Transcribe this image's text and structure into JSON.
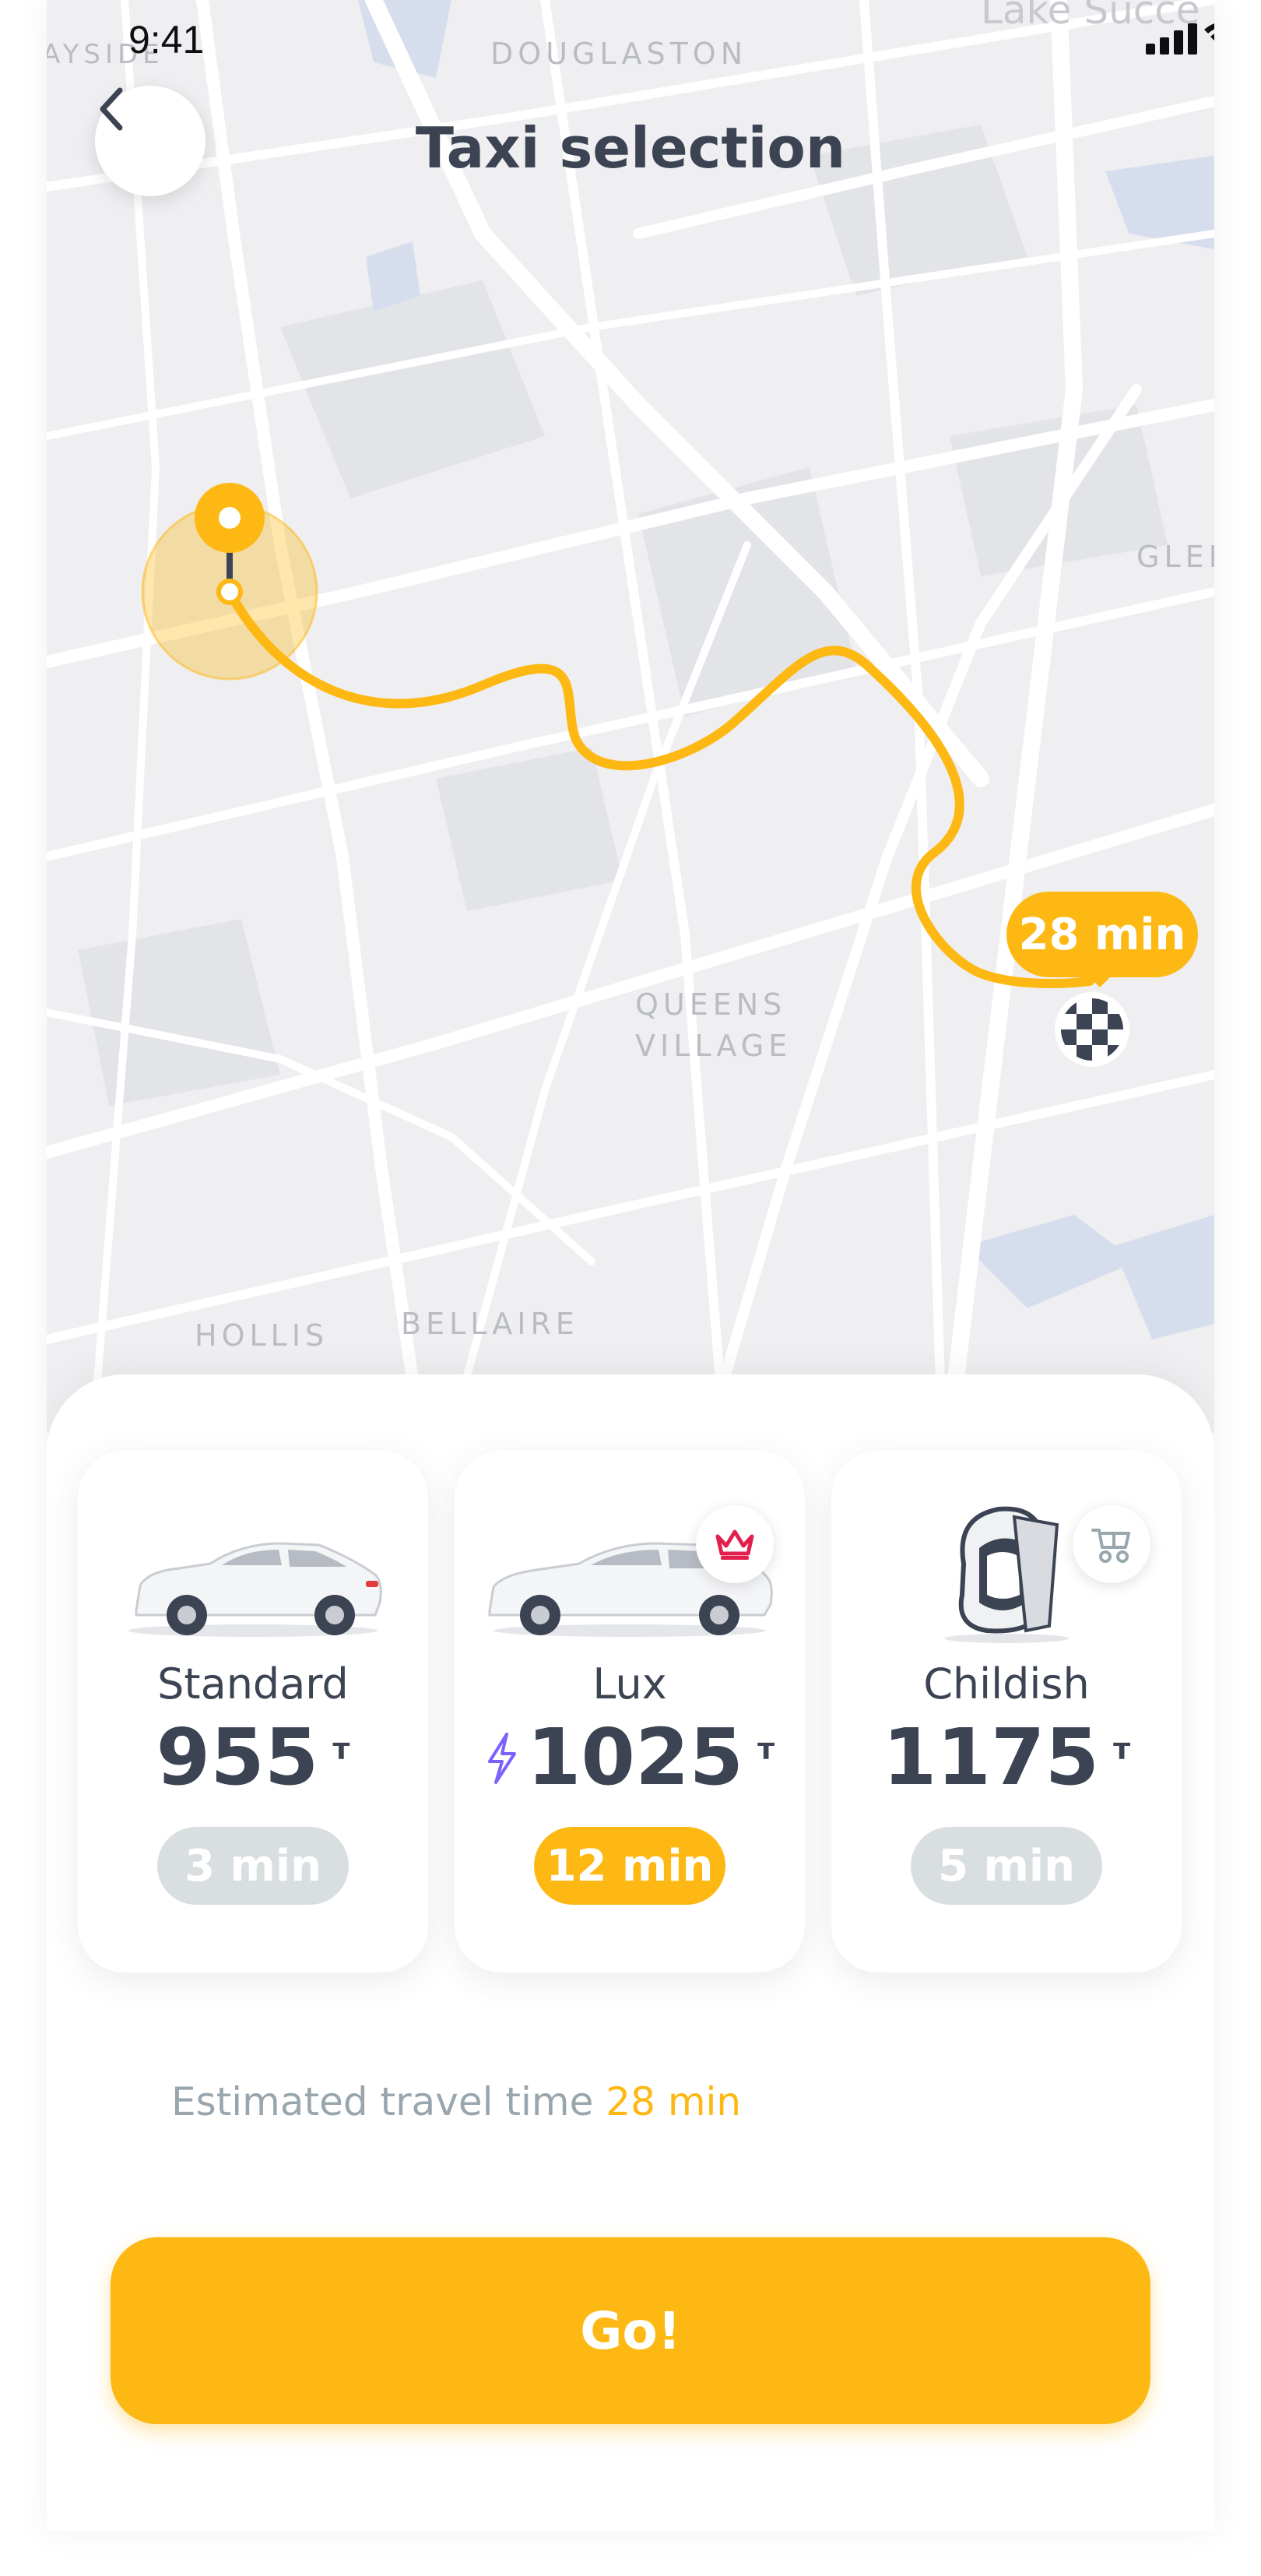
{
  "status_bar": {
    "time": "9:41"
  },
  "header": {
    "title": "Taxi selection"
  },
  "map": {
    "labels": {
      "douglaston": "DOUGLASTON",
      "bayside": "AYSIDE",
      "lake_success": "Lake Succe",
      "glen": "GLEN",
      "queens_village_1": "QUEENS",
      "queens_village_2": "VILLAGE",
      "hollis": "HOLLIS",
      "bellaire": "BELLAIRE"
    },
    "eta_bubble": "28 min"
  },
  "options": [
    {
      "name": "Standard",
      "price": "955",
      "currency": "т",
      "time": "3 min",
      "selected": false
    },
    {
      "name": "Lux",
      "price": "1025",
      "currency": "т",
      "time": "12 min",
      "selected": true
    },
    {
      "name": "Childish",
      "price": "1175",
      "currency": "т",
      "time": "5 min",
      "selected": false
    }
  ],
  "estimate": {
    "label": "Estimated travel time",
    "value": "28 min"
  },
  "go_button": {
    "label": "Go!"
  },
  "colors": {
    "accent": "#fdb813",
    "text": "#3c4453",
    "muted": "#99a6ae",
    "pill_gray": "#d9dee1",
    "map_bg": "#efeff1"
  },
  "icons": {
    "back": "chevron-left-icon",
    "crown": "crown-icon",
    "stroller": "stroller-icon",
    "bolt": "lightning-icon",
    "finish": "checkered-flag-icon"
  }
}
